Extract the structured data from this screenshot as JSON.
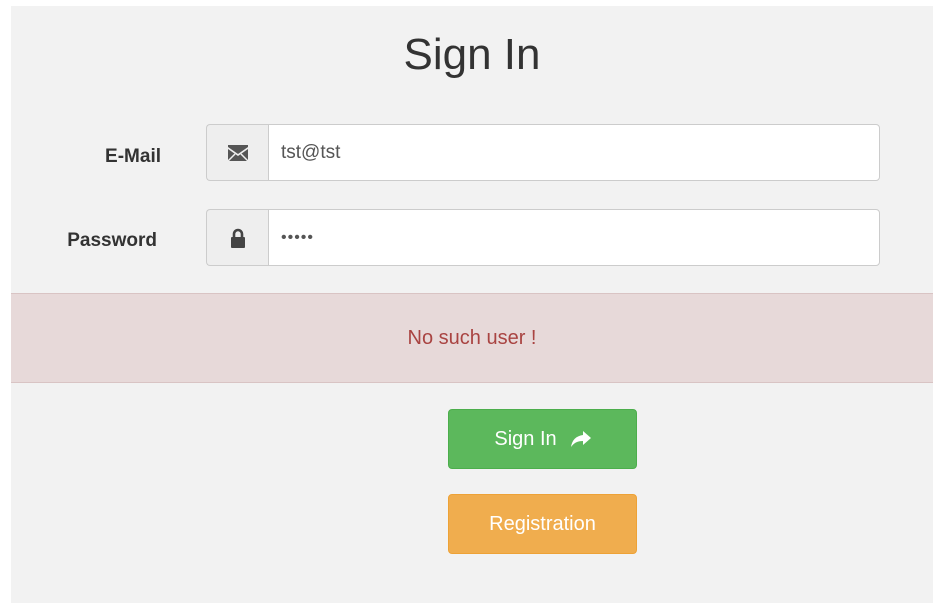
{
  "form": {
    "title": "Sign In",
    "email": {
      "label": "E-Mail",
      "value": "tst@tst",
      "icon": "envelope-icon"
    },
    "password": {
      "label": "Password",
      "value": "•••••",
      "icon": "lock-icon"
    },
    "alert": {
      "message": "No such user !"
    },
    "buttons": {
      "sign_in": "Sign In",
      "sign_in_icon": "share-arrow-icon",
      "registration": "Registration"
    }
  },
  "colors": {
    "panel_bg": "#f2f2f2",
    "alert_bg": "#e7d9d9",
    "alert_text": "#a94442",
    "success": "#5cb85c",
    "warning": "#f0ad4e"
  }
}
